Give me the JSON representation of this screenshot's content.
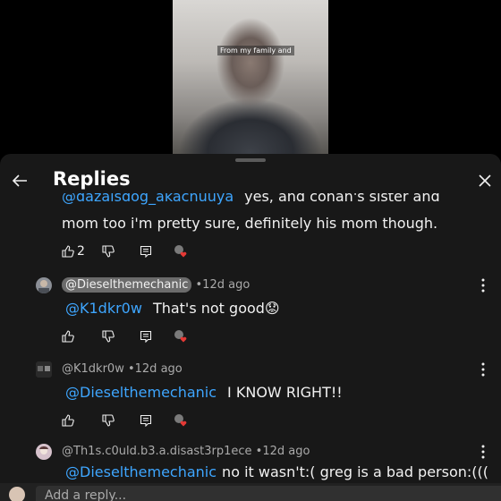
{
  "video": {
    "caption": "From my family and"
  },
  "panel": {
    "title": "Replies"
  },
  "comments": [
    {
      "mention": "@dazaisdog_akachuuya",
      "text_line1": "yes, and conan's sister and",
      "text_line2": "mom too i'm pretty sure, definitely his mom though.",
      "like_count": "2"
    },
    {
      "author": "@Dieselthemechanic",
      "time": "12d ago",
      "mention": "@K1dkr0w",
      "text": "That's not good😟"
    },
    {
      "author": "@K1dkr0w",
      "time": "12d ago",
      "mention": "@Dieselthemechanic",
      "text": "I KNOW RIGHT!!"
    },
    {
      "author": "@Th1s.c0uld.b3.a.disast3rp1ece",
      "time": "12d ago",
      "mention": "@Dieselthemechanic",
      "text": "no it wasn't:( greg is a bad person:((("
    }
  ],
  "reply_bar": {
    "placeholder": "Add a reply..."
  },
  "icons": {
    "back": "arrow-left-icon",
    "close": "close-icon",
    "like": "thumbs-up-icon",
    "dislike": "thumbs-down-icon",
    "reply": "comment-icon",
    "creator_heart": "creator-heart-icon",
    "more": "more-vertical-icon"
  },
  "colors": {
    "sheet_bg": "#181818",
    "mention": "#3ea6ff",
    "heart": "#e53935"
  }
}
